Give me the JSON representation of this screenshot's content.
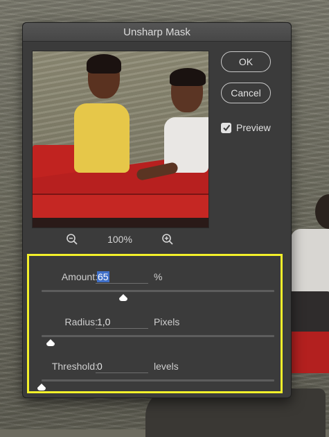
{
  "dialog": {
    "title": "Unsharp Mask",
    "ok_label": "OK",
    "cancel_label": "Cancel",
    "preview_label": "Preview",
    "preview_checked": true,
    "zoom_level": "100%"
  },
  "settings": {
    "amount": {
      "label": "Amount:",
      "value": "65",
      "unit": "%",
      "slider_fraction": 0.35
    },
    "radius": {
      "label": "Radius:",
      "value": "1,0",
      "unit": "Pixels",
      "slider_fraction": 0.04
    },
    "threshold": {
      "label": "Threshold:",
      "value": "0",
      "unit": "levels",
      "slider_fraction": 0.0
    }
  },
  "colors": {
    "highlight": "#f3f02a",
    "dialog_bg": "#3b3b3b",
    "selection": "#3f6fc8"
  },
  "icons": [
    "zoom-out-icon",
    "zoom-in-icon",
    "checkmark-icon",
    "slider-thumb-icon"
  ]
}
